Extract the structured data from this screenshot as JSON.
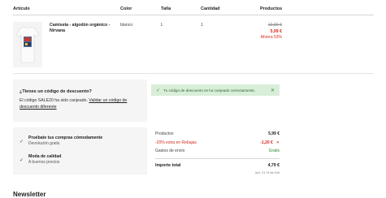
{
  "table_headers": {
    "article": "Artículo",
    "color": "Color",
    "size": "Talla",
    "quantity": "Cantidad",
    "products": "Productos"
  },
  "item": {
    "name": "Camiseta - algodón orgánico - Nirvana",
    "color": "blanco",
    "size": "L",
    "quantity": "1",
    "price_old": "12,99 €",
    "price_new": "5,99 €",
    "savings": "Ahorra 53%"
  },
  "discount": {
    "title": "¿Tienes un código de descuento?",
    "text": "El código SALE20 ha sido canjeado.",
    "link": "Validar un código de descuento diferente"
  },
  "success_banner": {
    "message": "Tu código de descuento se ha canjeado correctamente."
  },
  "benefits": [
    {
      "title": "Pruébate tus compras cómodamente",
      "subtitle": "Devolución gratis"
    },
    {
      "title": "Moda de calidad",
      "subtitle": "A buenos precios"
    }
  ],
  "summary": {
    "products_label": "Productos",
    "products_value": "5,99 €",
    "discount_label": "-20% extra en Rebajas",
    "discount_value": "-1,20 €",
    "shipping_label": "Gastos de envío",
    "shipping_value": "Gratis",
    "total_label": "Importe total",
    "total_value": "4,79 €",
    "vat_note": "incl. 21 % de IVA"
  },
  "newsletter_title": "Newsletter",
  "colors": {
    "sale_red": "#d42a1d",
    "success_green": "#2f8a34",
    "success_bg": "#d9eed8"
  }
}
